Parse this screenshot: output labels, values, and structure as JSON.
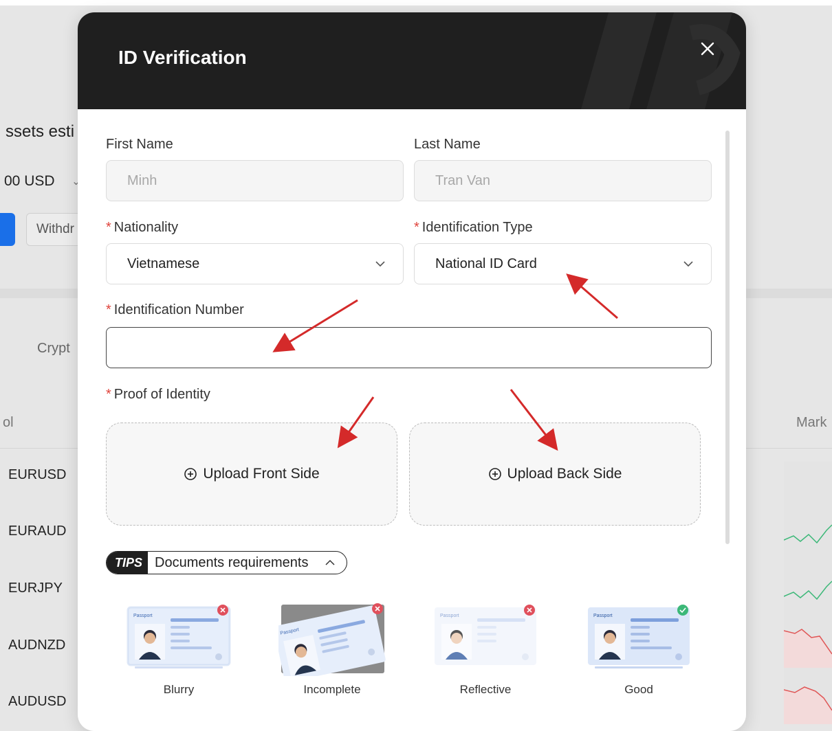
{
  "background": {
    "assets_label": "ssets esti",
    "balance": "00  USD",
    "withdraw_label": "Withdr",
    "crypto_tab": "Crypt",
    "symbol_header": "ol",
    "market_header": "Mark",
    "symbols": [
      "EURUSD",
      "EURAUD",
      "EURJPY",
      "AUDNZD",
      "AUDUSD"
    ]
  },
  "modal": {
    "title": "ID Verification",
    "close_icon": "close-icon",
    "first_name": {
      "label": "First Name",
      "value": "Minh"
    },
    "last_name": {
      "label": "Last Name",
      "value": "Tran Van"
    },
    "nationality": {
      "required_mark": "*",
      "label": "Nationality",
      "value": "Vietnamese"
    },
    "id_type": {
      "required_mark": "*",
      "label": "Identification Type",
      "value": "National ID Card"
    },
    "id_number": {
      "required_mark": "*",
      "label": "Identification Number",
      "value": ""
    },
    "proof": {
      "required_mark": "*",
      "label": "Proof of Identity",
      "front_label": "Upload Front Side",
      "back_label": "Upload Back Side"
    },
    "tips": {
      "badge": "TIPS",
      "text": "Documents requirements"
    },
    "doc_examples": [
      {
        "caption": "Blurry",
        "status": "bad",
        "card_text": "Passport"
      },
      {
        "caption": "Incomplete",
        "status": "bad",
        "card_text": "Passport"
      },
      {
        "caption": "Reflective",
        "status": "bad",
        "card_text": "Passport"
      },
      {
        "caption": "Good",
        "status": "good",
        "card_text": "Passport"
      }
    ]
  },
  "colors": {
    "header_bg": "#1f1f1f",
    "required": "#e0443c",
    "annotation_arrow": "#d42a2a",
    "bad_badge": "#e0505c",
    "good_badge": "#3cb878"
  }
}
